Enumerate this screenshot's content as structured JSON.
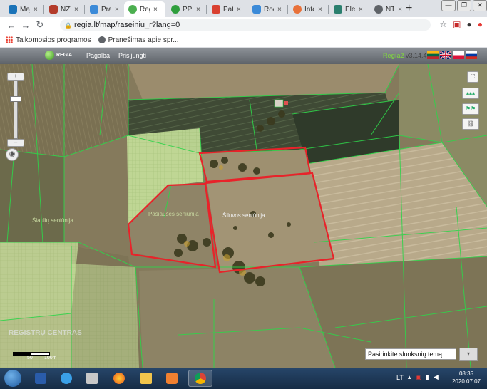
{
  "browser": {
    "tabs": [
      {
        "label": "Maj",
        "favicon_color": "#1a73b8",
        "active": false
      },
      {
        "label": "NZT",
        "favicon_color": "#b33b2a",
        "active": false
      },
      {
        "label": "Pra",
        "favicon_color": "#3b8ad8",
        "active": false
      },
      {
        "label": "Reg",
        "favicon_color": "#4caf50",
        "active": true
      },
      {
        "label": "PPR",
        "favicon_color": "#2e9e3c",
        "active": false
      },
      {
        "label": "Pat",
        "favicon_color": "#d94030",
        "active": false
      },
      {
        "label": "Roc",
        "favicon_color": "#3b8ad8",
        "active": false
      },
      {
        "label": "Inte",
        "favicon_color": "#e8713a",
        "active": false
      },
      {
        "label": "Elel",
        "favicon_color": "#2a7f6e",
        "active": false
      },
      {
        "label": "NT",
        "favicon_color": "#5f6368",
        "active": false
      }
    ],
    "tab_close_glyph": "×",
    "new_tab_glyph": "+",
    "url": "regia.lt/map/raseiniu_r?lang=0",
    "bookmarks": [
      {
        "label": "Taikomosios programos",
        "icon": "apps-grid-icon"
      },
      {
        "label": "Pranešimas apie spr...",
        "icon": "globe-icon"
      }
    ]
  },
  "app": {
    "logo_text": "REGIA",
    "menu": [
      "Pagalba",
      "Prisijungti"
    ],
    "brand": "Regia",
    "brand_suffix": "2",
    "version": " v3.14.4",
    "languages": [
      "lt",
      "en",
      "pl",
      "ru"
    ]
  },
  "map": {
    "labels": [
      {
        "text": "Šiluvos seniūnija"
      },
      {
        "text": "Pašiaušės seniūnija"
      },
      {
        "text": "Šiaulių seniūnija"
      }
    ],
    "watermark": "REGISTRŲ CENTRAS",
    "scale_labels": [
      "50",
      "100m"
    ],
    "layer_select_placeholder": "Pasirinkite sluoksnių temą",
    "colors": {
      "parcel_outline": "#2fd44a",
      "selected_outline": "#e8232a",
      "hatched_area": "#c9e6a0"
    }
  },
  "taskbar": {
    "language": "LT",
    "time": "08:35",
    "date": "2020.07.07"
  }
}
